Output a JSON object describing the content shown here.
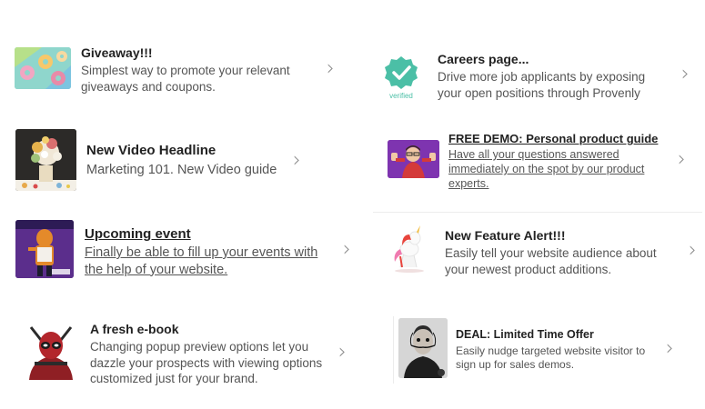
{
  "cards": [
    {
      "title": "Giveaway!!!",
      "desc": "Simplest way to promote your relevant giveaways and coupons.",
      "thumb": "donut-pattern-image"
    },
    {
      "title": "New Video Headline",
      "desc": "Marketing 101. New Video guide",
      "thumb": "flower-vase-art-image"
    },
    {
      "title": "Upcoming event",
      "desc": "Finally be able to fill up your events with the help of your website.",
      "thumb": "tiger-mascot-image"
    },
    {
      "title": "A fresh e-book",
      "desc": "Changing popup preview options let you dazzle your prospects with viewing options customized just for your brand.",
      "thumb": "deadpool-image"
    },
    {
      "title": "Careers page...",
      "desc": "Drive more job applicants by exposing your open positions through Provenly",
      "thumb": "verified-badge-icon",
      "badge_text": "verified"
    },
    {
      "title": "FREE DEMO: Personal product guide",
      "desc": "Have all your questions answered immediately on the spot by our product experts.",
      "thumb": "presenter-photo"
    },
    {
      "title": "New Feature Alert!!!",
      "desc": "Easily tell your website audience about your newest product additions.",
      "thumb": "unicorn-image"
    },
    {
      "title": "DEAL: Limited Time Offer",
      "desc": "Easily nudge targeted website visitor to sign up for sales demos.",
      "thumb": "dali-portrait-image"
    }
  ],
  "icons": {
    "chevron": "chevron-right-icon"
  },
  "colors": {
    "verified_badge": "#4bbfa6",
    "title_text": "#222222",
    "desc_text": "#555555",
    "chevron": "#8a8a8a"
  }
}
